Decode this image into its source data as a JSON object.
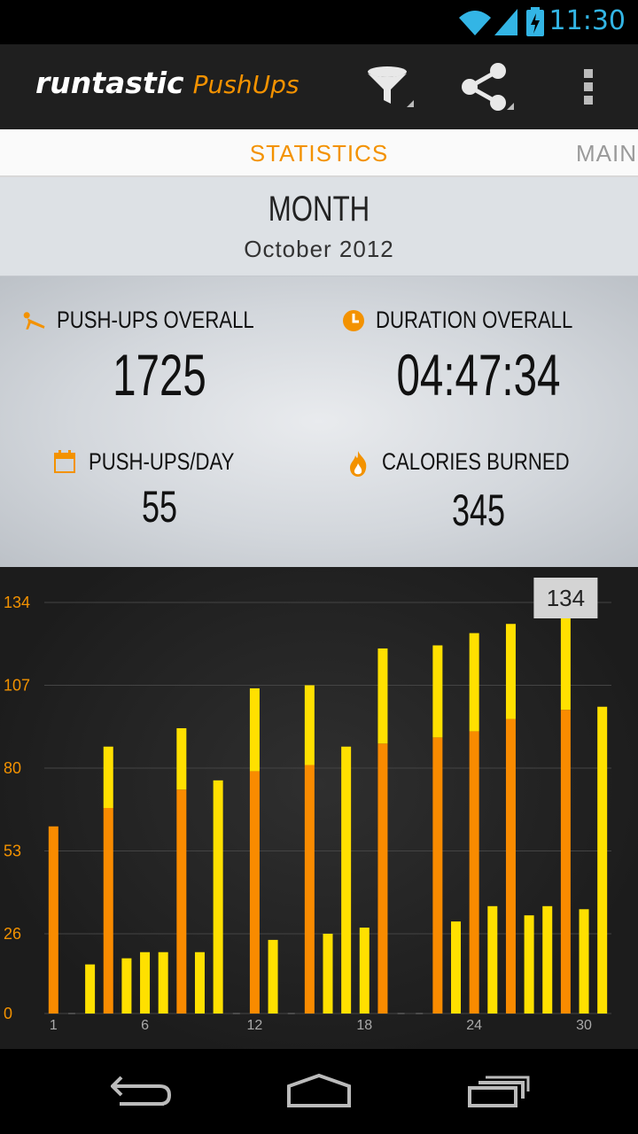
{
  "status_bar": {
    "time": "11:30",
    "icons": [
      "wifi-icon",
      "signal-icon",
      "battery-charging-icon"
    ]
  },
  "action_bar": {
    "brand_main": "runtastic",
    "brand_sub": "PushUps",
    "actions": [
      "filter-icon",
      "share-icon",
      "overflow-menu-icon"
    ]
  },
  "tabs": {
    "active": "STATISTICS",
    "next": "MAIN"
  },
  "period": {
    "name": "MONTH",
    "range": "October 2012"
  },
  "stats": {
    "pushups_overall": {
      "label": "PUSH-UPS OVERALL",
      "value": "1725",
      "icon": "pushup-icon"
    },
    "duration_overall": {
      "label": "DURATION OVERALL",
      "value": "04:47:34",
      "icon": "clock-icon"
    },
    "pushups_per_day": {
      "label": "PUSH-UPS/DAY",
      "value": "55",
      "icon": "calendar-icon"
    },
    "calories_burned": {
      "label": "CALORIES BURNED",
      "value": "345",
      "icon": "flame-icon"
    }
  },
  "chart_data": {
    "type": "bar",
    "stacked": true,
    "y_ticks": [
      "0",
      "26",
      "53",
      "80",
      "107",
      "134"
    ],
    "ylim": [
      0,
      134
    ],
    "x_ticks": [
      "1",
      "6",
      "12",
      "18",
      "24",
      "30"
    ],
    "x_tick_days": [
      1,
      6,
      12,
      18,
      24,
      30
    ],
    "grid": true,
    "tooltip": {
      "day": 29,
      "value": "134"
    },
    "colors": {
      "base": "#f98b00",
      "top": "#ffe000"
    },
    "days": [
      1,
      2,
      3,
      4,
      5,
      6,
      7,
      8,
      9,
      10,
      11,
      12,
      13,
      14,
      15,
      16,
      17,
      18,
      19,
      20,
      21,
      22,
      23,
      24,
      25,
      26,
      27,
      28,
      29,
      30,
      31
    ],
    "series": [
      {
        "values": [
          61,
          0,
          0,
          67,
          0,
          0,
          0,
          73,
          0,
          0,
          0,
          79,
          0,
          0,
          81,
          0,
          0,
          0,
          88,
          0,
          0,
          90,
          0,
          92,
          0,
          96,
          0,
          0,
          99,
          0,
          0
        ]
      },
      {
        "values": [
          0,
          0,
          16,
          20,
          18,
          20,
          20,
          20,
          20,
          76,
          0,
          27,
          24,
          0,
          26,
          26,
          87,
          28,
          31,
          0,
          0,
          30,
          30,
          32,
          35,
          31,
          32,
          35,
          35,
          34,
          100
        ]
      }
    ]
  }
}
